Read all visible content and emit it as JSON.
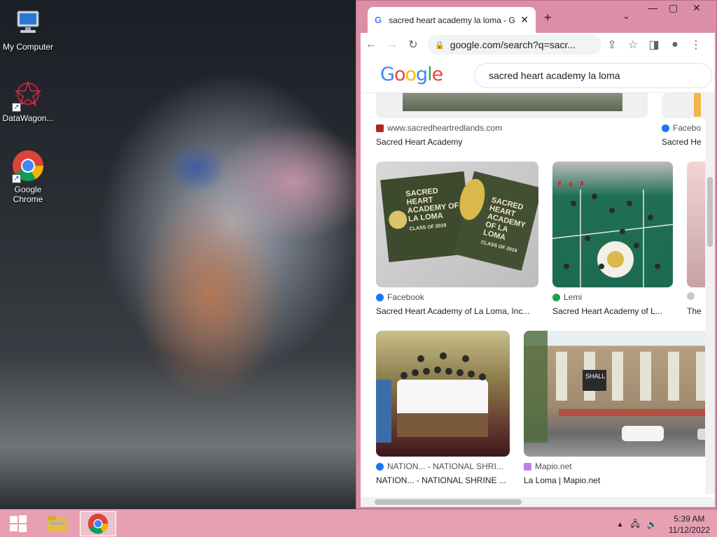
{
  "desktop": {
    "icons": [
      {
        "label": "My Computer"
      },
      {
        "label": "DataWagon..."
      },
      {
        "label": "Google Chrome"
      }
    ]
  },
  "browser": {
    "tab_title": "sacred heart academy la loma - G",
    "new_tab": "+",
    "url": "google.com/search?q=sacr...",
    "search_query": "sacred heart academy la loma",
    "results": [
      {
        "source": "www.sacredheartredlands.com",
        "caption": "Sacred Heart Academy"
      },
      {
        "source": "Facebo",
        "caption": "Sacred He"
      },
      {
        "source": "Facebook",
        "caption": "Sacred Heart Academy of La Loma, Inc..."
      },
      {
        "source": "Lemi",
        "caption": "Sacred Heart Academy of L..."
      },
      {
        "source": "",
        "caption": "The"
      },
      {
        "source": "NATION... - NATIONAL SHRI...",
        "caption": "NATION... - NATIONAL SHRINE ..."
      },
      {
        "source": "Mapio.net",
        "caption": "La Loma | Mapio.net"
      }
    ],
    "thumb_text": {
      "badge_left": "SACRED HEART ACADEMY OF LA LOMA",
      "badge_left_sub": "CLASS OF 2019",
      "badge_right": "SACRED HEART ACADEMY OF LA LOMA",
      "badge_right_sub": "CLASS OF 2019",
      "bldg_sign": "SHALL"
    }
  },
  "taskbar": {
    "time": "5:39 AM",
    "date": "11/12/2022"
  }
}
